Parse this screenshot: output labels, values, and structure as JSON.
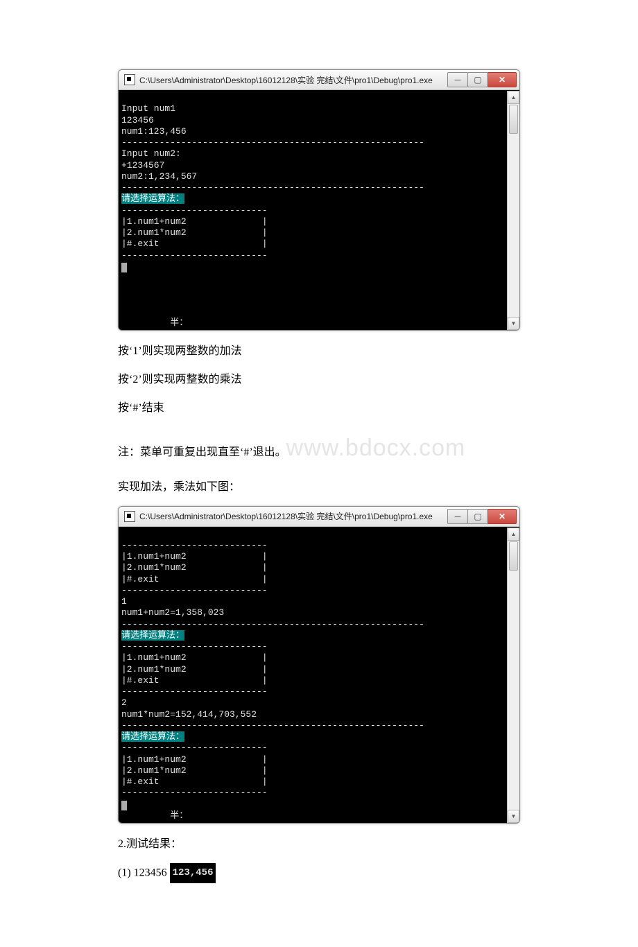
{
  "window1": {
    "title": "C:\\Users\\Administrator\\Desktop\\16012128\\实验 完结\\文件\\pro1\\Debug\\pro1.exe",
    "lines": {
      "l0": "Input num1",
      "l1": "123456",
      "l2": "num1:123,456",
      "l3": "--------------------------------------------------------",
      "l4": "Input num2:",
      "l5": "+1234567",
      "l6": "num2:1,234,567",
      "l7": "--------------------------------------------------------",
      "l8": "请选择运算法：",
      "l9": "---------------------------",
      "l10": "|1.num1+num2              |",
      "l11": "|2.num1*num2              |",
      "l12": "|#.exit                   |",
      "l13": "---------------------------",
      "footer": "半："
    }
  },
  "text": {
    "t1": "按‘1’则实现两整数的加法",
    "t2": "按‘2’则实现两整数的乘法",
    "t3": "按‘#’结束",
    "t4a": "注：菜单可重复出现直至‘#’退出。",
    "t5": "实现加法，乘法如下图：",
    "t6": "2.测试结果：",
    "t7_prefix": "(1) 123456 ",
    "t7_chip": "123,456"
  },
  "watermark": {
    "full": "www.bdocx.com"
  },
  "window2": {
    "title": "C:\\Users\\Administrator\\Desktop\\16012128\\实验 完结\\文件\\pro1\\Debug\\pro1.exe",
    "lines": {
      "l0": "---------------------------",
      "l1": "|1.num1+num2              |",
      "l2": "|2.num1*num2              |",
      "l3": "|#.exit                   |",
      "l4": "---------------------------",
      "l5": "1",
      "l6": "num1+num2=1,358,023",
      "l7": "--------------------------------------------------------",
      "l8": "请选择运算法：",
      "l9": "---------------------------",
      "l10": "|1.num1+num2              |",
      "l11": "|2.num1*num2              |",
      "l12": "|#.exit                   |",
      "l13": "---------------------------",
      "l14": "2",
      "l15": "num1*num2=152,414,703,552",
      "l16": "--------------------------------------------------------",
      "l17": "请选择运算法：",
      "l18": "---------------------------",
      "l19": "|1.num1+num2              |",
      "l20": "|2.num1*num2              |",
      "l21": "|#.exit                   |",
      "l22": "---------------------------",
      "footer": "半："
    }
  }
}
